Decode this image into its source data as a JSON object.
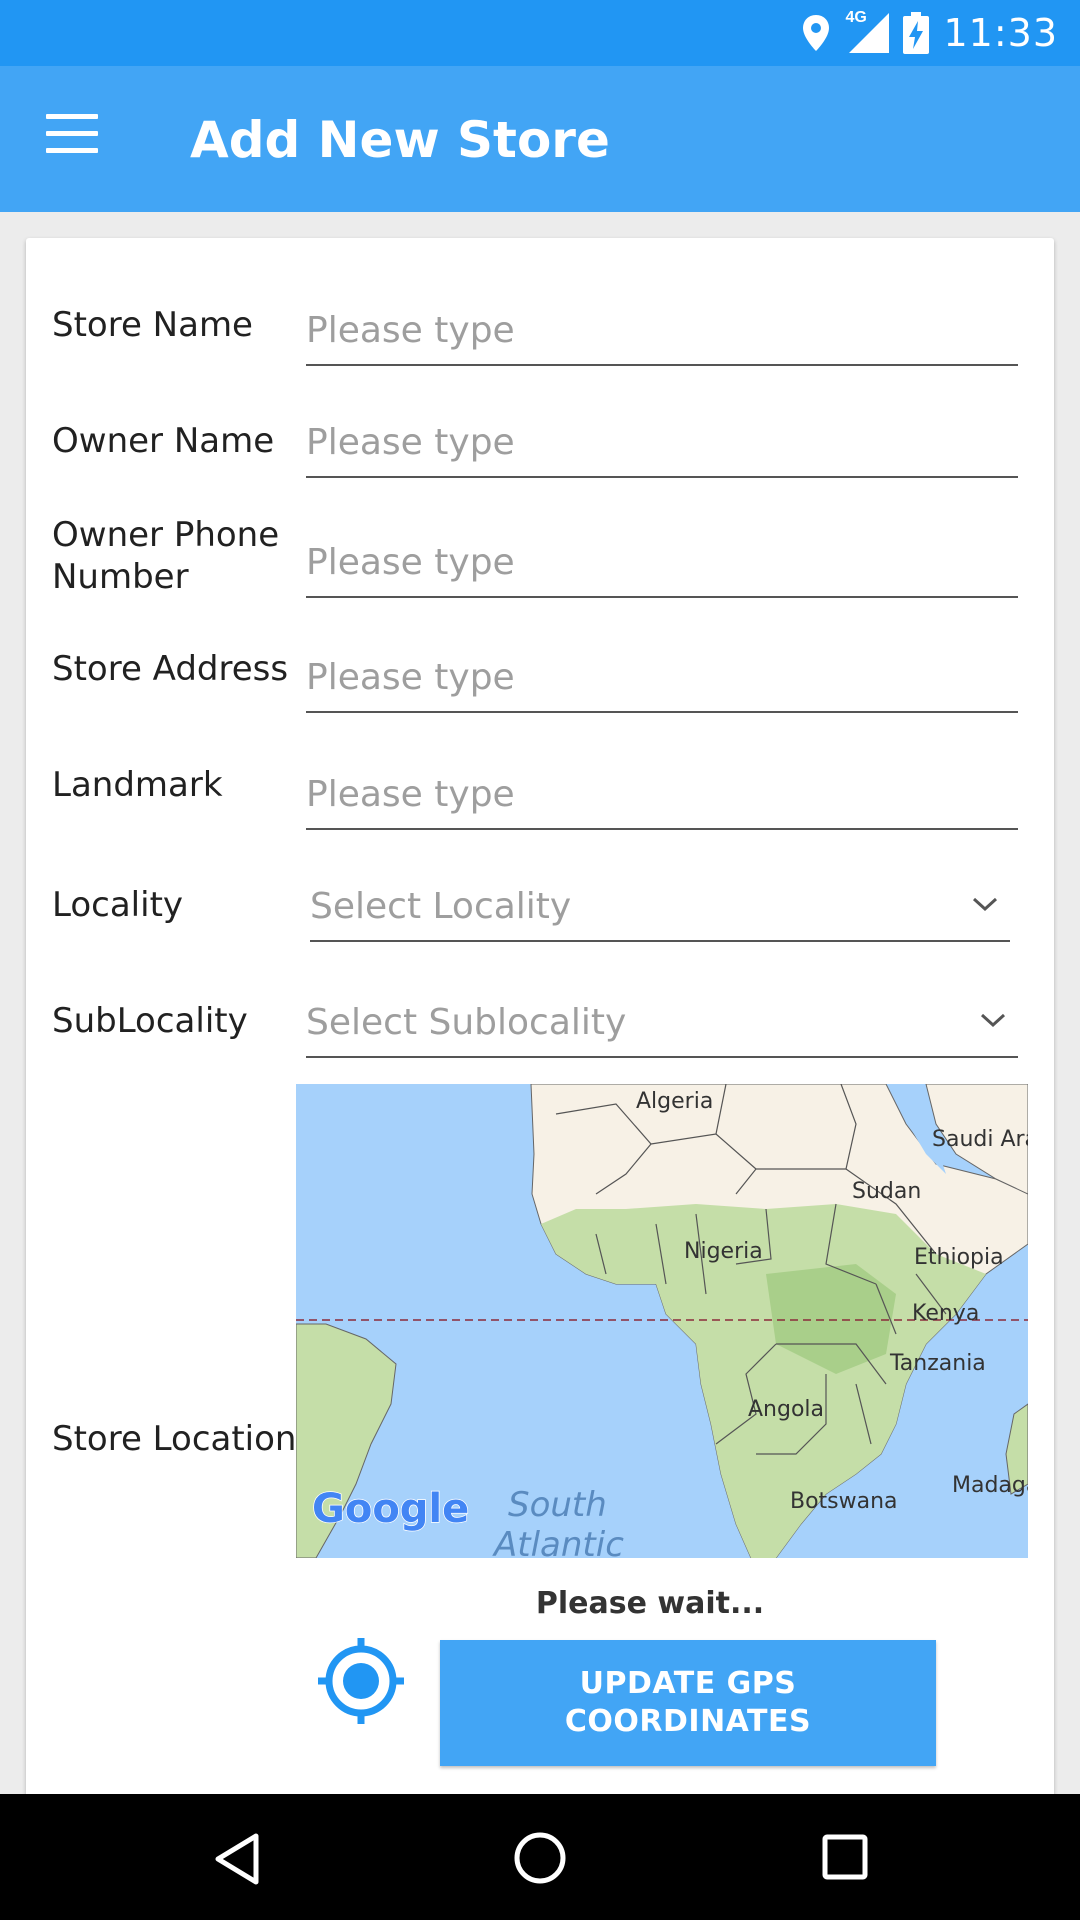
{
  "status_bar": {
    "time": "11:33",
    "network": "4G",
    "icons": [
      "location-icon",
      "signal-icon",
      "battery-charging-icon"
    ]
  },
  "app_bar": {
    "title": "Add New Store",
    "menu_icon": "hamburger-menu-icon"
  },
  "form": {
    "store_name": {
      "label": "Store Name",
      "placeholder": "Please type",
      "value": ""
    },
    "owner_name": {
      "label": "Owner Name",
      "placeholder": "Please type",
      "value": ""
    },
    "owner_phone": {
      "label_line1": "Owner Phone",
      "label_line2": "Number",
      "placeholder": "Please type",
      "value": ""
    },
    "store_address": {
      "label": "Store Address",
      "placeholder": "Please type",
      "value": ""
    },
    "landmark": {
      "label": "Landmark",
      "placeholder": "Please type",
      "value": ""
    },
    "locality": {
      "label": "Locality",
      "selected": "Select Locality"
    },
    "sublocality": {
      "label": "SubLocality",
      "selected": "Select Sublocality"
    },
    "store_location": {
      "label": "Store Location"
    }
  },
  "map": {
    "logo": "Google",
    "labels": {
      "algeria": "Algeria",
      "saudi": "Saudi Ara",
      "sudan": "Sudan",
      "nigeria": "Nigeria",
      "ethiopia": "Ethiopia",
      "kenya": "Kenya",
      "tanzania": "Tanzania",
      "angola": "Angola",
      "botswana": "Botswana",
      "madagascar": "Madaga",
      "ocean_line1": "South",
      "ocean_line2": "Atlantic"
    },
    "colors": {
      "water": "#a6d1fb",
      "land": "#f7f1e6",
      "vegetation": "#c5dea8",
      "equator": "#8b2b3a"
    }
  },
  "gps": {
    "status": "Please wait...",
    "button_label": "UPDATE GPS COORDINATES",
    "icon": "gps-target-icon"
  },
  "nav_bar": {
    "icons": [
      "back-icon",
      "home-icon",
      "recents-icon"
    ]
  },
  "colors": {
    "status_bar": "#2196f3",
    "app_bar": "#42a5f5",
    "accent": "#42a5f5"
  }
}
